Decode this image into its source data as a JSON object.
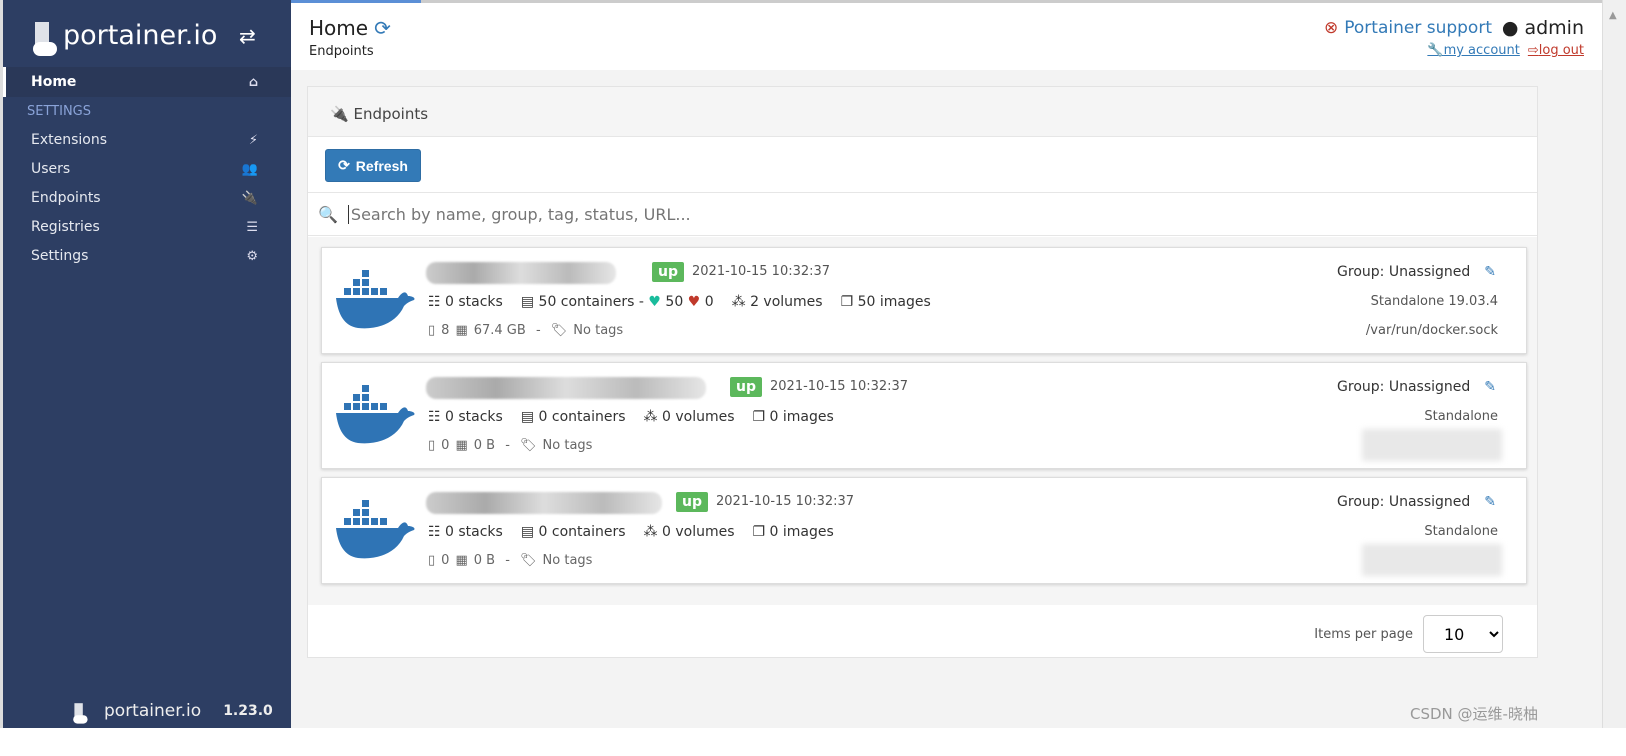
{
  "sidebar": {
    "logo": "portainer.io",
    "home": "Home",
    "section": "SETTINGS",
    "items": [
      {
        "label": "Extensions",
        "icon": "⚡"
      },
      {
        "label": "Users",
        "icon": "👥"
      },
      {
        "label": "Endpoints",
        "icon": "🔌"
      },
      {
        "label": "Registries",
        "icon": "☰"
      },
      {
        "label": "Settings",
        "icon": "⚙"
      }
    ],
    "footer_logo": "portainer.io",
    "version": "1.23.0"
  },
  "header": {
    "title": "Home",
    "subtitle": "Endpoints",
    "support": "Portainer support",
    "user": "admin",
    "my_account": "my account",
    "log_out": "log out"
  },
  "panel": {
    "title": "Endpoints",
    "refresh": "Refresh",
    "search_placeholder": "Search by name, group, tag, status, URL..."
  },
  "endpoints": [
    {
      "status": "up",
      "date": "2021-10-15 10:32:37",
      "stacks": "0 stacks",
      "containers": "50 containers -",
      "healthy": "50",
      "unhealthy": "0",
      "volumes": "2 volumes",
      "images": "50 images",
      "cpu": "8",
      "memory": "67.4 GB",
      "tags": "No tags",
      "group": "Group: Unassigned",
      "type": "Standalone 19.03.4",
      "url": "/var/run/docker.sock"
    },
    {
      "status": "up",
      "date": "2021-10-15 10:32:37",
      "stacks": "0 stacks",
      "containers": "0 containers",
      "volumes": "0 volumes",
      "images": "0 images",
      "cpu": "0",
      "memory": "0 B",
      "tags": "No tags",
      "group": "Group: Unassigned",
      "type": "Standalone"
    },
    {
      "status": "up",
      "date": "2021-10-15 10:32:37",
      "stacks": "0 stacks",
      "containers": "0 containers",
      "volumes": "0 volumes",
      "images": "0 images",
      "cpu": "0",
      "memory": "0 B",
      "tags": "No tags",
      "group": "Group: Unassigned",
      "type": "Standalone"
    }
  ],
  "pagination": {
    "label": "Items per page",
    "value": "10"
  },
  "watermark": "CSDN @运维-晓柚",
  "colors": {
    "sidebar": "#2d3e63",
    "primary": "#337ab7",
    "up": "#5cb85c",
    "danger": "#c0392b"
  }
}
